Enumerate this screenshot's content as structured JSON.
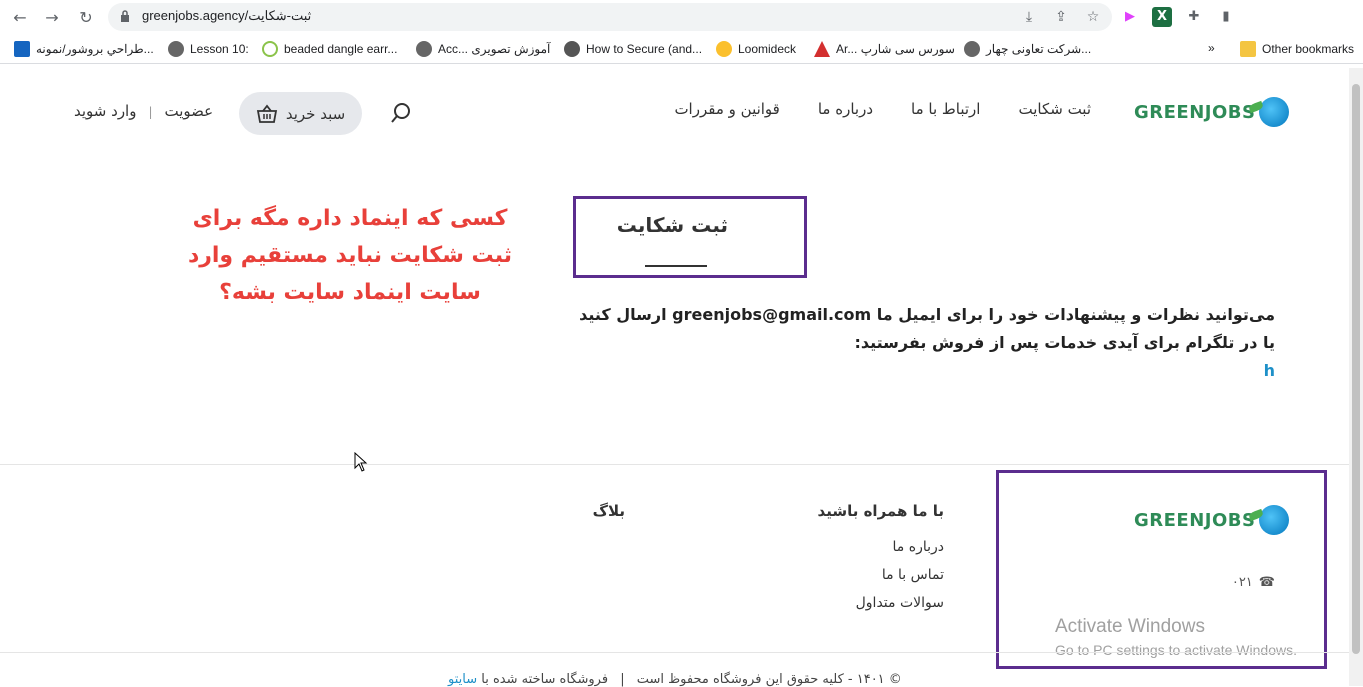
{
  "browser": {
    "url_domain": "greenjobs.agency/",
    "url_path": "ثبت-شکایت",
    "bookmarks": [
      "طراحي بروشور/نمونه...",
      "Lesson 10:",
      "beaded dangle earr...",
      "Acc... آموزش تصویری",
      "How to Secure (and...",
      "Loomideck",
      "Ar... سورس سی شارپ",
      "شرکت تعاونی چهار...",
      "Other bookmarks"
    ],
    "more_label": "»"
  },
  "header": {
    "logo": "GREENJOBS",
    "nav": [
      "ثبت شکایت",
      "ارتباط با ما",
      "درباره ما",
      "قوانین و مقررات"
    ],
    "cart_label": "سبد خرید",
    "signup": "عضویت",
    "login": "وارد شوید",
    "separator": "|"
  },
  "page": {
    "title": "ثبت شکایت",
    "annotation_lines": [
      "کسی که اینماد داره مگه برای",
      "ثبت شکایت نباید مستقیم وارد",
      "سایت اینماد سایت بشه؟"
    ],
    "line1": "می‌توانید نظرات و پیشنهادات خود را برای ایمیل ما greenjobs@gmail.com ارسال کنید",
    "line2": "یا در تلگرام برای آیدی خدمات پس از فروش بفرستید:",
    "line3": "h"
  },
  "footer": {
    "logo": "GREENJOBS",
    "phone": "۰۲۱",
    "col1_title": "با ما همراه باشید",
    "col1_links": [
      "درباره ما",
      "تماس با ما",
      "سوالات متداول"
    ],
    "col2_title": "بلاگ",
    "copyright_main": "© ۱۴۰۱ - کلیه حقوق این فروشگاه محفوظ است",
    "copyright_sep": "|",
    "copyright_built": "فروشگاه ساخته شده با",
    "copyright_link": "سایتو"
  },
  "watermark": {
    "line1": "Activate Windows",
    "line2": "Go to PC settings to activate Windows."
  }
}
